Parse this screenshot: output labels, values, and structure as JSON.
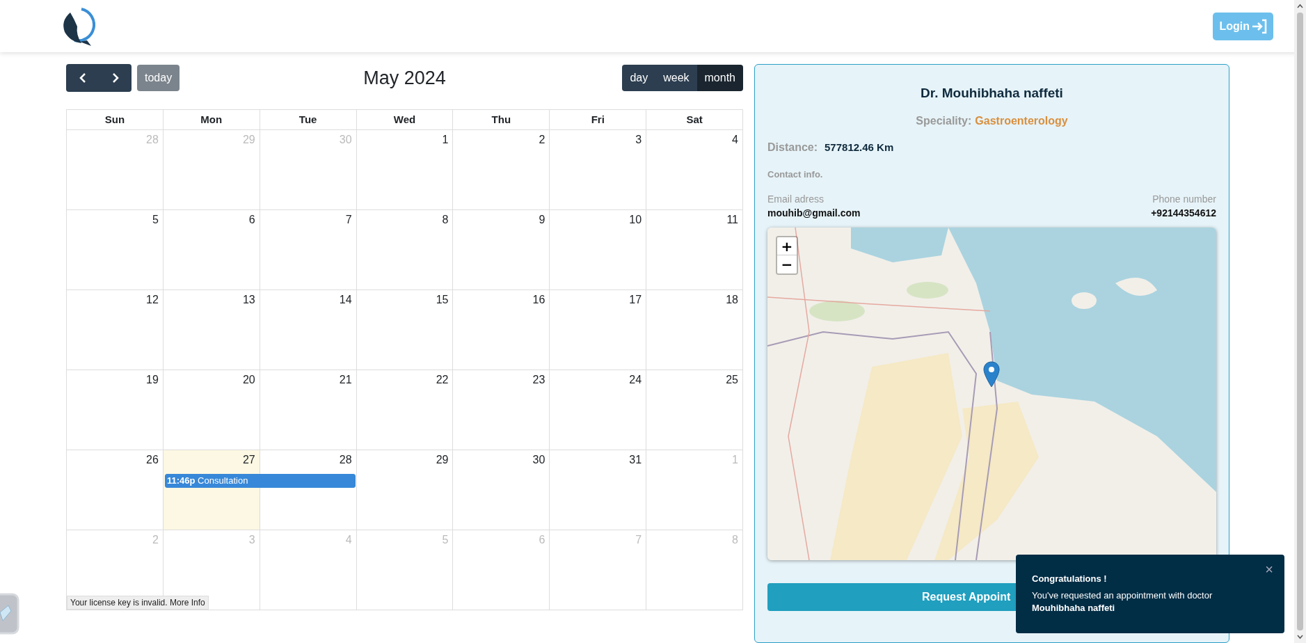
{
  "header": {
    "login_button": "Login"
  },
  "calendar": {
    "title": "May 2024",
    "today_button": "today",
    "views": [
      {
        "label": "day",
        "selected": false
      },
      {
        "label": "week",
        "selected": false
      },
      {
        "label": "month",
        "selected": true
      }
    ],
    "weekdays": [
      "Sun",
      "Mon",
      "Tue",
      "Wed",
      "Thu",
      "Fri",
      "Sat"
    ],
    "weeks": [
      [
        {
          "label": "28",
          "other_month": true
        },
        {
          "label": "29",
          "other_month": true
        },
        {
          "label": "30",
          "other_month": true
        },
        {
          "label": "1",
          "other_month": false
        },
        {
          "label": "2",
          "other_month": false
        },
        {
          "label": "3",
          "other_month": false
        },
        {
          "label": "4",
          "other_month": false
        }
      ],
      [
        {
          "label": "5",
          "other_month": false
        },
        {
          "label": "6",
          "other_month": false
        },
        {
          "label": "7",
          "other_month": false
        },
        {
          "label": "8",
          "other_month": false
        },
        {
          "label": "9",
          "other_month": false
        },
        {
          "label": "10",
          "other_month": false
        },
        {
          "label": "11",
          "other_month": false
        }
      ],
      [
        {
          "label": "12",
          "other_month": false
        },
        {
          "label": "13",
          "other_month": false
        },
        {
          "label": "14",
          "other_month": false
        },
        {
          "label": "15",
          "other_month": false
        },
        {
          "label": "16",
          "other_month": false
        },
        {
          "label": "17",
          "other_month": false
        },
        {
          "label": "18",
          "other_month": false
        }
      ],
      [
        {
          "label": "19",
          "other_month": false
        },
        {
          "label": "20",
          "other_month": false
        },
        {
          "label": "21",
          "other_month": false
        },
        {
          "label": "22",
          "other_month": false
        },
        {
          "label": "23",
          "other_month": false
        },
        {
          "label": "24",
          "other_month": false
        },
        {
          "label": "25",
          "other_month": false
        }
      ],
      [
        {
          "label": "26",
          "other_month": false
        },
        {
          "label": "27",
          "other_month": false,
          "today": true,
          "event": {
            "time": "11:46p",
            "title": "Consultation"
          }
        },
        {
          "label": "28",
          "other_month": false,
          "event_continued": true
        },
        {
          "label": "29",
          "other_month": false
        },
        {
          "label": "30",
          "other_month": false
        },
        {
          "label": "31",
          "other_month": false
        },
        {
          "label": "1",
          "other_month": true
        }
      ],
      [
        {
          "label": "2",
          "other_month": true
        },
        {
          "label": "3",
          "other_month": true
        },
        {
          "label": "4",
          "other_month": true
        },
        {
          "label": "5",
          "other_month": true
        },
        {
          "label": "6",
          "other_month": true
        },
        {
          "label": "7",
          "other_month": true
        },
        {
          "label": "8",
          "other_month": true
        }
      ]
    ],
    "license_notice": {
      "text": "Your license key is invalid.",
      "link": "More Info"
    }
  },
  "doctor_card": {
    "name": "Dr. Mouhibhaha naffeti",
    "speciality_label": "Speciality:",
    "speciality": "Gastroenterology",
    "distance_label": "Distance:",
    "distance": "577812.46 Km",
    "contact_heading": "Contact info.",
    "email_label": "Email adress",
    "email": "mouhib@gmail.com",
    "phone_label": "Phone number",
    "phone": "+92144354612",
    "map": {
      "kind": "picture",
      "zoom_in": "+",
      "zoom_out": "−"
    },
    "request_button": "Request Appoint"
  },
  "toast": {
    "title": "Congratulations !",
    "message": "You've requested an appointment with doctor",
    "doctor": "Mouhibhaha naffeti",
    "close": "×"
  }
}
